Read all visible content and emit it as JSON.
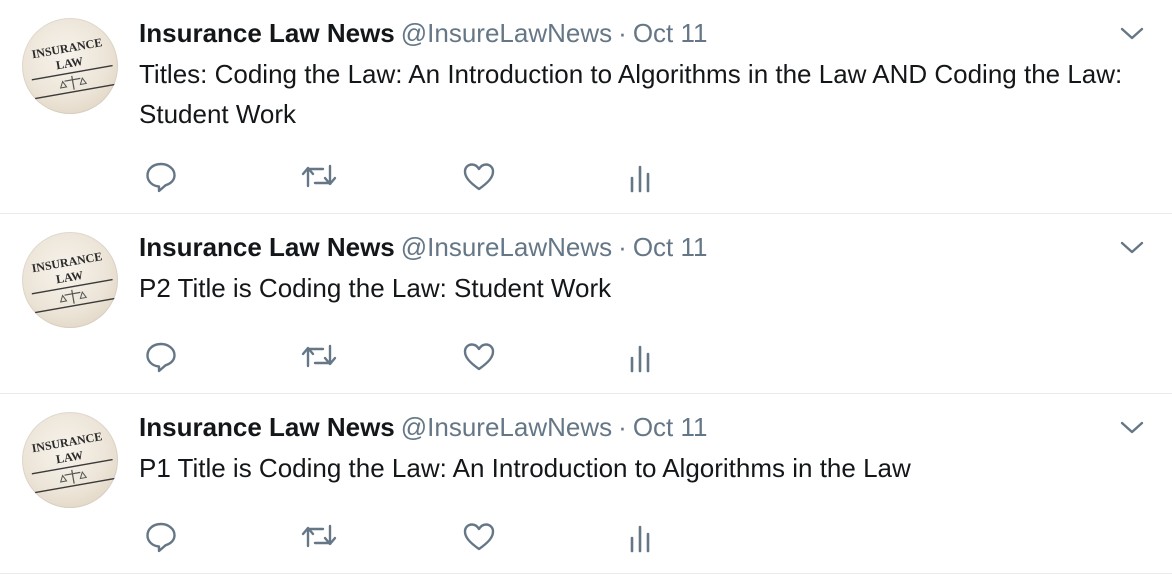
{
  "tweets": [
    {
      "name": "Insurance Law News",
      "handle": "@InsureLawNews",
      "separator": "·",
      "time": "Oct 11",
      "text": "Titles: Coding the Law: An Introduction to Algorithms in the Law AND Coding the Law: Student Work",
      "avatar": {
        "line1": "INSURANCE",
        "line2": "LAW"
      }
    },
    {
      "name": "Insurance Law News",
      "handle": "@InsureLawNews",
      "separator": "·",
      "time": "Oct 11",
      "text": "P2 Title is Coding the Law: Student Work",
      "avatar": {
        "line1": "INSURANCE",
        "line2": "LAW"
      }
    },
    {
      "name": "Insurance Law News",
      "handle": "@InsureLawNews",
      "separator": "·",
      "time": "Oct 11",
      "text": "P1 Title is Coding the Law: An Introduction to Algorithms in the Law",
      "avatar": {
        "line1": "INSURANCE",
        "line2": "LAW"
      }
    }
  ],
  "icons": {
    "reply": "reply-icon",
    "retweet": "retweet-icon",
    "like": "heart-icon",
    "stats": "analytics-icon",
    "caret": "chevron-down-icon"
  },
  "colors": {
    "text": "#14171a",
    "secondary": "#657786",
    "divider": "#e6ecf0"
  }
}
